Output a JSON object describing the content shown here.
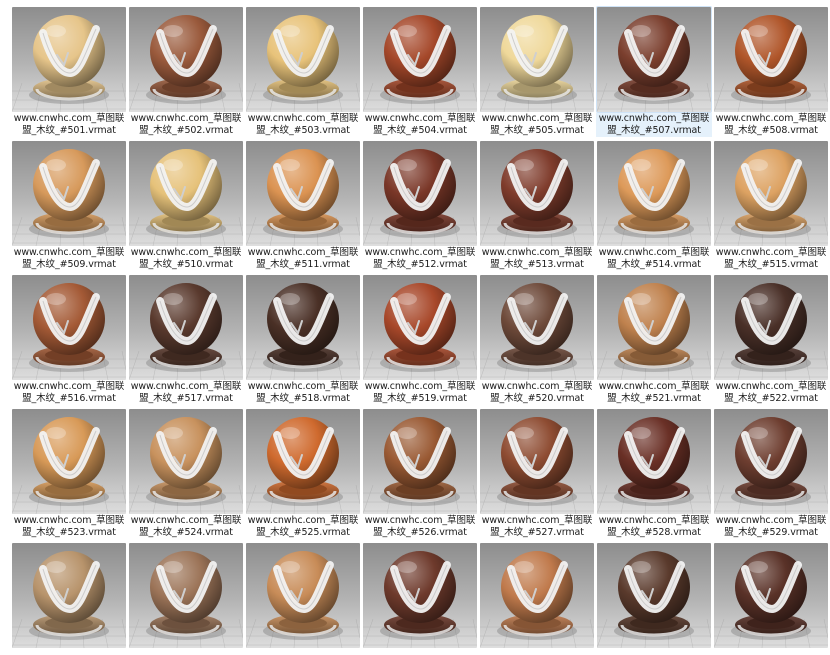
{
  "items": [
    {
      "line1": "www.cnwhc.com_草图联",
      "line2": "盟_木纹_#501.vrmat",
      "tone": "#e6c58a",
      "selected": false
    },
    {
      "line1": "www.cnwhc.com_草图联",
      "line2": "盟_木纹_#502.vrmat",
      "tone": "#9a5a3c",
      "selected": false
    },
    {
      "line1": "www.cnwhc.com_草图联",
      "line2": "盟_木纹_#503.vrmat",
      "tone": "#e8c37a",
      "selected": false
    },
    {
      "line1": "www.cnwhc.com_草图联",
      "line2": "盟_木纹_#504.vrmat",
      "tone": "#a5482a",
      "selected": false
    },
    {
      "line1": "www.cnwhc.com_草图联",
      "line2": "盟_木纹_#505.vrmat",
      "tone": "#efd89a",
      "selected": false
    },
    {
      "line1": "www.cnwhc.com_草图联",
      "line2": "盟_木纹_#507.vrmat",
      "tone": "#7b3f2e",
      "selected": true
    },
    {
      "line1": "www.cnwhc.com_草图联",
      "line2": "盟_木纹_#508.vrmat",
      "tone": "#b0562a",
      "selected": false
    },
    {
      "line1": "www.cnwhc.com_草图联",
      "line2": "盟_木纹_#509.vrmat",
      "tone": "#d79a5c",
      "selected": false
    },
    {
      "line1": "www.cnwhc.com_草图联",
      "line2": "盟_木纹_#510.vrmat",
      "tone": "#e6c27a",
      "selected": false
    },
    {
      "line1": "www.cnwhc.com_草图联",
      "line2": "盟_木纹_#511.vrmat",
      "tone": "#db9352",
      "selected": false
    },
    {
      "line1": "www.cnwhc.com_草图联",
      "line2": "盟_木纹_#512.vrmat",
      "tone": "#7a3728",
      "selected": false
    },
    {
      "line1": "www.cnwhc.com_草图联",
      "line2": "盟_木纹_#513.vrmat",
      "tone": "#7f3c2c",
      "selected": false
    },
    {
      "line1": "www.cnwhc.com_草图联",
      "line2": "盟_木纹_#514.vrmat",
      "tone": "#dd9a5a",
      "selected": false
    },
    {
      "line1": "www.cnwhc.com_草图联",
      "line2": "盟_木纹_#515.vrmat",
      "tone": "#dda262",
      "selected": false
    },
    {
      "line1": "www.cnwhc.com_草图联",
      "line2": "盟_木纹_#516.vrmat",
      "tone": "#a45a36",
      "selected": false
    },
    {
      "line1": "www.cnwhc.com_草图联",
      "line2": "盟_木纹_#517.vrmat",
      "tone": "#5a3a2e",
      "selected": false
    },
    {
      "line1": "www.cnwhc.com_草图联",
      "line2": "盟_木纹_#518.vrmat",
      "tone": "#4a3026",
      "selected": false
    },
    {
      "line1": "www.cnwhc.com_草图联",
      "line2": "盟_木纹_#519.vrmat",
      "tone": "#a8482a",
      "selected": false
    },
    {
      "line1": "www.cnwhc.com_草图联",
      "line2": "盟_木纹_#520.vrmat",
      "tone": "#6e4a3a",
      "selected": false
    },
    {
      "line1": "www.cnwhc.com_草图联",
      "line2": "盟_木纹_#521.vrmat",
      "tone": "#c0824e",
      "selected": false
    },
    {
      "line1": "www.cnwhc.com_草图联",
      "line2": "盟_木纹_#522.vrmat",
      "tone": "#4a3028",
      "selected": false
    },
    {
      "line1": "www.cnwhc.com_草图联",
      "line2": "盟_木纹_#523.vrmat",
      "tone": "#d89a58",
      "selected": false
    },
    {
      "line1": "www.cnwhc.com_草图联",
      "line2": "盟_木纹_#524.vrmat",
      "tone": "#c8925e",
      "selected": false
    },
    {
      "line1": "www.cnwhc.com_草图联",
      "line2": "盟_木纹_#525.vrmat",
      "tone": "#cf6a2e",
      "selected": false
    },
    {
      "line1": "www.cnwhc.com_草图联",
      "line2": "盟_木纹_#526.vrmat",
      "tone": "#9a5a34",
      "selected": false
    },
    {
      "line1": "www.cnwhc.com_草图联",
      "line2": "盟_木纹_#527.vrmat",
      "tone": "#8e4c32",
      "selected": false
    },
    {
      "line1": "www.cnwhc.com_草图联",
      "line2": "盟_木纹_#528.vrmat",
      "tone": "#6a3026",
      "selected": false
    },
    {
      "line1": "www.cnwhc.com_草图联",
      "line2": "盟_木纹_#529.vrmat",
      "tone": "#6e3e30",
      "selected": false
    },
    {
      "line1": "",
      "line2": "",
      "tone": "#b8946c",
      "selected": false
    },
    {
      "line1": "",
      "line2": "",
      "tone": "#9c7458",
      "selected": false
    },
    {
      "line1": "",
      "line2": "",
      "tone": "#c88c58",
      "selected": false
    },
    {
      "line1": "",
      "line2": "",
      "tone": "#6e3a2c",
      "selected": false
    },
    {
      "line1": "",
      "line2": "",
      "tone": "#c07a4c",
      "selected": false
    },
    {
      "line1": "",
      "line2": "",
      "tone": "#5a3a2c",
      "selected": false
    },
    {
      "line1": "",
      "line2": "",
      "tone": "#5a3228",
      "selected": false
    }
  ]
}
